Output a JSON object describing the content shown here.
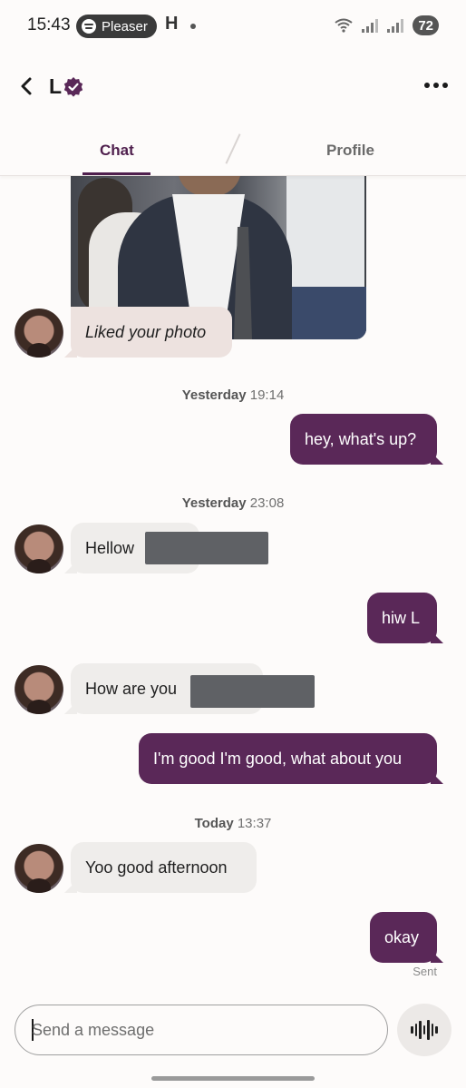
{
  "status_bar": {
    "time": "15:43",
    "media_app": "Pleaser",
    "network_icon": "H",
    "battery": "72"
  },
  "header": {
    "name": "L",
    "verified_icon": "verified-badge-icon",
    "more_icon": "more-dots-icon"
  },
  "tabs": [
    {
      "label": "Chat",
      "active": true
    },
    {
      "label": "Profile",
      "active": false
    }
  ],
  "messages": {
    "liked": "Liked your photo",
    "ts1_day": "Yesterday",
    "ts1_time": "19:14",
    "out1": "hey, what's up?",
    "ts2_day": "Yesterday",
    "ts2_time": "23:08",
    "in1": "Hellow",
    "out2": "hiw L",
    "in2": "How are you",
    "out3": "I'm good I'm good, what about you",
    "ts3_day": "Today",
    "ts3_time": "13:37",
    "in3": "Yoo good afternoon",
    "out4": "okay",
    "status": "Sent"
  },
  "composer": {
    "placeholder": "Send a message",
    "voice_icon": "voice-wave-icon"
  },
  "colors": {
    "brand": "#4f1f4d",
    "outgoing_bubble": "#5a2858",
    "incoming_bubble": "#efedeb",
    "liked_bubble": "#ede2df"
  }
}
